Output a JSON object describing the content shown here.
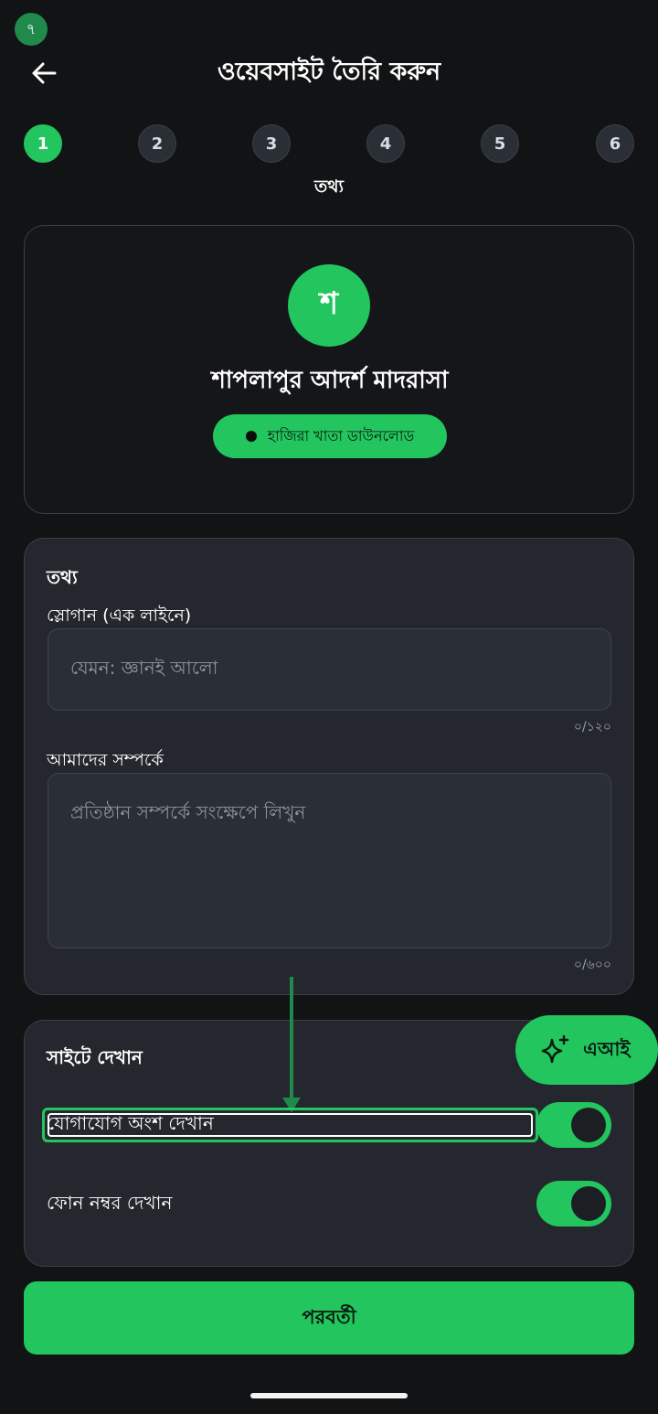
{
  "status": {
    "badge": "৭"
  },
  "header": {
    "title": "ওয়েবসাইট তৈরি করুন"
  },
  "steps": {
    "items": [
      "1",
      "2",
      "3",
      "4",
      "5",
      "6"
    ],
    "active_index": 0,
    "caption": "তথ্য"
  },
  "profile": {
    "avatar_letter": "শ",
    "name": "শাপলাপুর আদর্শ মাদরাসা",
    "attendance_button": "হাজিরা খাতা ডাউনলোড"
  },
  "info": {
    "section_title": "তথ্য",
    "slogan_label": "স্লোগান (এক লাইনে)",
    "slogan_placeholder": "যেমন: জ্ঞানই আলো",
    "slogan_counter": "০/১২০",
    "about_label": "আমাদের সম্পর্কে",
    "about_placeholder": "প্রতিষ্ঠান সম্পর্কে সংক্ষেপে লিখুন",
    "about_counter": "০/৬০০"
  },
  "display": {
    "section_title": "সাইটে দেখান",
    "toggles": [
      {
        "label": "যোগাযোগ অংশ দেখান",
        "on": true
      },
      {
        "label": "ফোন নম্বর দেখান",
        "on": true
      }
    ]
  },
  "ai_button": {
    "label": "এআই"
  },
  "next_button": {
    "label": "পরবর্তী"
  },
  "colors": {
    "accent": "#22c55e",
    "background": "#111315",
    "card": "#24282e"
  }
}
